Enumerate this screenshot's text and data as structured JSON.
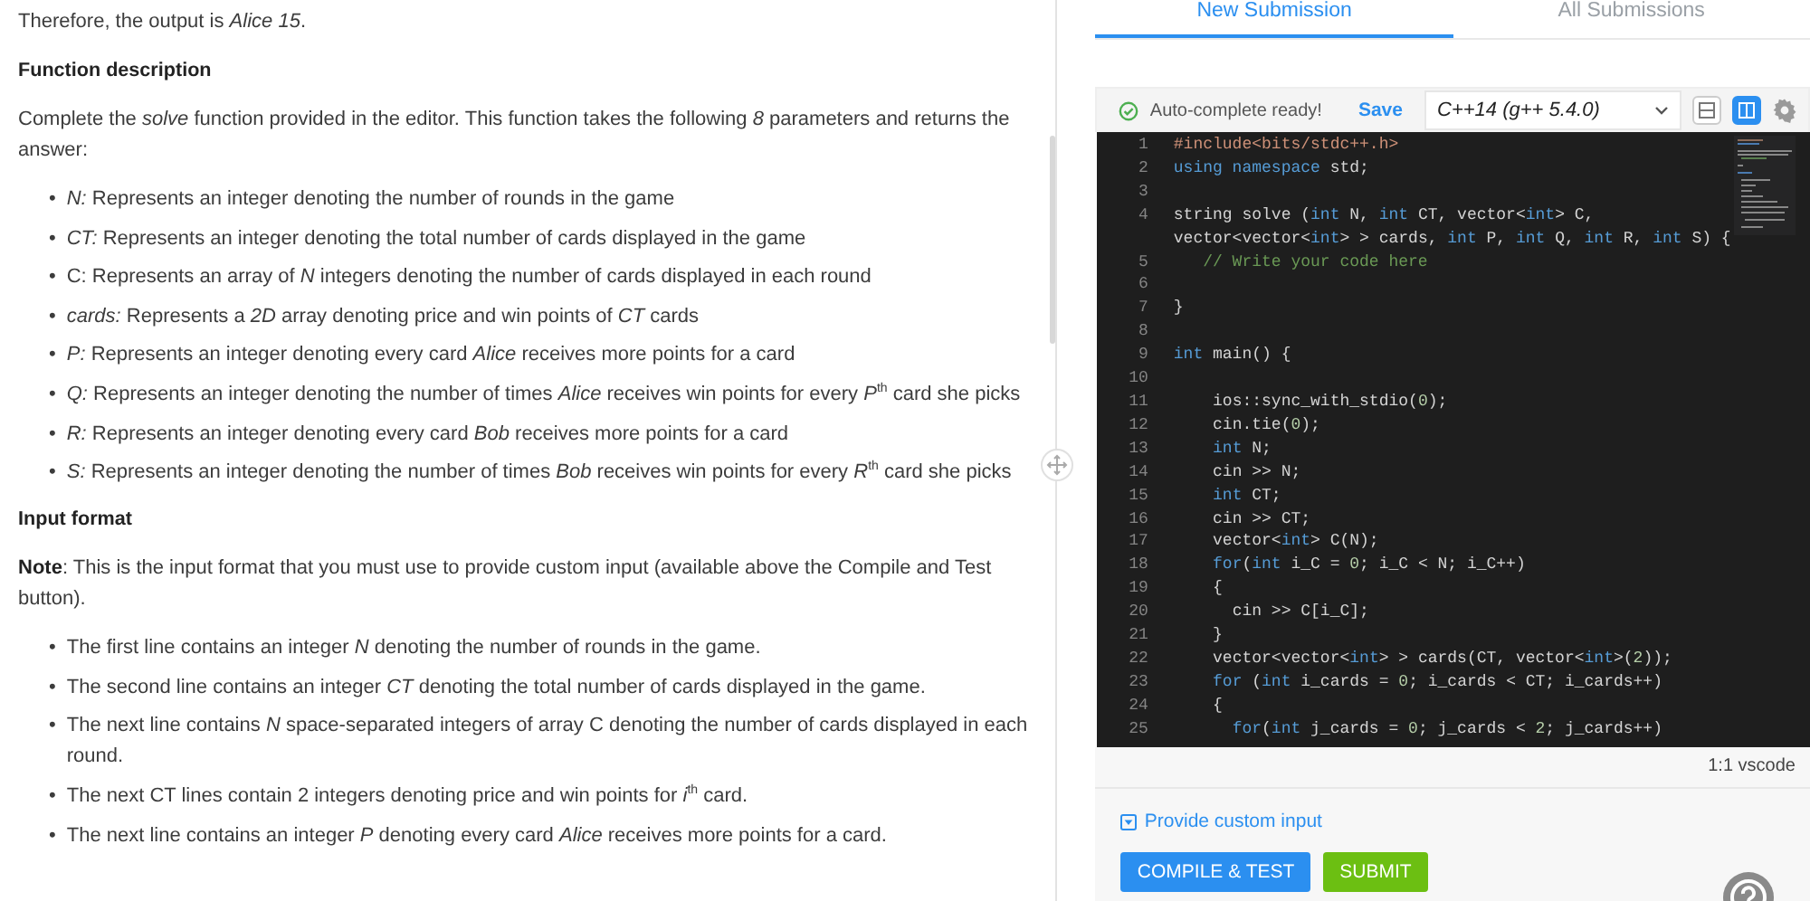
{
  "description": {
    "blocks": [
      {
        "kind": "paragraph",
        "text": "Therefore, the output is *Alice 15*."
      },
      {
        "kind": "heading",
        "text": "Function description"
      },
      {
        "kind": "paragraph",
        "text": "Complete the *solve* function provided in the editor. This function takes the following *8* parameters and returns the answer:"
      },
      {
        "kind": "bullets",
        "marker": "•",
        "items": [
          "*N:* Represents an integer denoting the number of rounds in the game",
          "*CT:* Represents an integer denoting the total number of cards displayed in the game",
          "C: Represents an array of *N* integers denoting the number of cards displayed in each round",
          "*cards:* Represents a *2D* array denoting price and win points of *CT* cards",
          "*P:* Represents an integer denoting every card *Alice* receives more points for a card",
          "*Q:* Represents an integer denoting the number of times *Alice* receives win points for every *P*$^{th}$ card she picks",
          "*R:* Represents an integer denoting every card *Bob* receives more points for a card",
          "*S:* Represents an integer denoting the number of times *Bob* receives win points for every *R*$^{th}$ card she picks"
        ]
      },
      {
        "kind": "heading",
        "text": "Input format"
      },
      {
        "kind": "paragraph",
        "text": "**Note**: This is the input format that you must use to provide custom input (available above the Compile and Test button)."
      },
      {
        "kind": "bullets",
        "marker": "•",
        "items": [
          "The first line contains an integer *N* denoting the number of rounds in the game.",
          "The second line contains an integer *CT* denoting the total number of cards displayed in the game.",
          "The next line contains *N* space-separated integers of array C denoting the number of cards displayed in each round.",
          "The next CT lines contain 2 integers denoting price and win points for *i*$^{th}$ card.",
          "The next line contains an integer *P* denoting every card *Alice* receives more points for a card."
        ]
      }
    ]
  },
  "tabs": [
    {
      "label": "New Submission",
      "selected": true
    },
    {
      "label": "All Submissions",
      "selected": false
    }
  ],
  "toolbar": {
    "status": "Auto-complete ready!",
    "save": "Save",
    "language": "C++14 (g++ 5.4.0)",
    "layouts": [
      {
        "kind": "stacked",
        "selected": false
      },
      {
        "kind": "split",
        "selected": true
      }
    ]
  },
  "editor": {
    "lines": [
      {
        "number": "1",
        "tokens": [
          {
            "kind": "pre",
            "text": "#include<bits/stdc++.h>"
          }
        ]
      },
      {
        "number": "2",
        "tokens": [
          {
            "kind": "kw",
            "text": "using namespace"
          },
          {
            "kind": "plain",
            "text": " std;"
          }
        ]
      },
      {
        "number": "3"
      },
      {
        "number": "4",
        "tokens": [
          {
            "kind": "plain",
            "text": "string solve ("
          },
          {
            "kind": "kw",
            "text": "int"
          },
          {
            "kind": "plain",
            "text": " N, "
          },
          {
            "kind": "kw",
            "text": "int"
          },
          {
            "kind": "plain",
            "text": " CT, vector<"
          },
          {
            "kind": "kw",
            "text": "int"
          },
          {
            "kind": "plain",
            "text": "> C, vector<vector<"
          },
          {
            "kind": "kw",
            "text": "int"
          },
          {
            "kind": "plain",
            "text": "> > cards, "
          },
          {
            "kind": "kw",
            "text": "int"
          },
          {
            "kind": "plain",
            "text": " P, "
          },
          {
            "kind": "kw",
            "text": "int"
          },
          {
            "kind": "plain",
            "text": " Q, "
          },
          {
            "kind": "kw",
            "text": "int"
          },
          {
            "kind": "plain",
            "text": " R, "
          },
          {
            "kind": "kw",
            "text": "int"
          },
          {
            "kind": "plain",
            "text": " S) {"
          }
        ]
      },
      {
        "number": "5",
        "tokens": [
          {
            "kind": "com",
            "text": "   // Write your code here"
          }
        ]
      },
      {
        "number": "6"
      },
      {
        "number": "7",
        "tokens": [
          {
            "kind": "plain",
            "text": "}"
          }
        ]
      },
      {
        "number": "8"
      },
      {
        "number": "9",
        "tokens": [
          {
            "kind": "kw",
            "text": "int"
          },
          {
            "kind": "plain",
            "text": " main() {"
          }
        ]
      },
      {
        "number": "10"
      },
      {
        "number": "11",
        "tokens": [
          {
            "kind": "plain",
            "text": "    ios::sync_with_stdio("
          },
          {
            "kind": "num",
            "text": "0"
          },
          {
            "kind": "plain",
            "text": ");"
          }
        ]
      },
      {
        "number": "12",
        "tokens": [
          {
            "kind": "plain",
            "text": "    cin.tie("
          },
          {
            "kind": "num",
            "text": "0"
          },
          {
            "kind": "plain",
            "text": ");"
          }
        ]
      },
      {
        "number": "13",
        "tokens": [
          {
            "kind": "kw",
            "text": "    int"
          },
          {
            "kind": "plain",
            "text": " N;"
          }
        ]
      },
      {
        "number": "14",
        "tokens": [
          {
            "kind": "plain",
            "text": "    cin >> N;"
          }
        ]
      },
      {
        "number": "15",
        "tokens": [
          {
            "kind": "kw",
            "text": "    int"
          },
          {
            "kind": "plain",
            "text": " CT;"
          }
        ]
      },
      {
        "number": "16",
        "tokens": [
          {
            "kind": "plain",
            "text": "    cin >> CT;"
          }
        ]
      },
      {
        "number": "17",
        "tokens": [
          {
            "kind": "plain",
            "text": "    vector<"
          },
          {
            "kind": "kw",
            "text": "int"
          },
          {
            "kind": "plain",
            "text": "> C(N);"
          }
        ]
      },
      {
        "number": "18",
        "tokens": [
          {
            "kind": "kw",
            "text": "    for"
          },
          {
            "kind": "plain",
            "text": "("
          },
          {
            "kind": "kw",
            "text": "int"
          },
          {
            "kind": "plain",
            "text": " i_C = "
          },
          {
            "kind": "num",
            "text": "0"
          },
          {
            "kind": "plain",
            "text": "; i_C < N; i_C++)"
          }
        ]
      },
      {
        "number": "19",
        "tokens": [
          {
            "kind": "plain",
            "text": "    {"
          }
        ]
      },
      {
        "number": "20",
        "tokens": [
          {
            "kind": "plain",
            "text": "      cin >> C[i_C];"
          }
        ]
      },
      {
        "number": "21",
        "tokens": [
          {
            "kind": "plain",
            "text": "    }"
          }
        ]
      },
      {
        "number": "22",
        "tokens": [
          {
            "kind": "plain",
            "text": "    vector<vector<"
          },
          {
            "kind": "kw",
            "text": "int"
          },
          {
            "kind": "plain",
            "text": "> > cards(CT, vector<"
          },
          {
            "kind": "kw",
            "text": "int"
          },
          {
            "kind": "plain",
            "text": ">("
          },
          {
            "kind": "num",
            "text": "2"
          },
          {
            "kind": "plain",
            "text": "));"
          }
        ]
      },
      {
        "number": "23",
        "tokens": [
          {
            "kind": "kw",
            "text": "    for"
          },
          {
            "kind": "plain",
            "text": " ("
          },
          {
            "kind": "kw",
            "text": "int"
          },
          {
            "kind": "plain",
            "text": " i_cards = "
          },
          {
            "kind": "num",
            "text": "0"
          },
          {
            "kind": "plain",
            "text": "; i_cards < CT; i_cards++)"
          }
        ]
      },
      {
        "number": "24",
        "tokens": [
          {
            "kind": "plain",
            "text": "    {"
          }
        ]
      },
      {
        "number": "25",
        "tokens": [
          {
            "kind": "kw",
            "text": "      for"
          },
          {
            "kind": "plain",
            "text": "("
          },
          {
            "kind": "kw",
            "text": "int"
          },
          {
            "kind": "plain",
            "text": " j_cards = "
          },
          {
            "kind": "num",
            "text": "0"
          },
          {
            "kind": "plain",
            "text": "; j_cards < "
          },
          {
            "kind": "num",
            "text": "2"
          },
          {
            "kind": "plain",
            "text": "; j_cards++)"
          }
        ]
      }
    ]
  },
  "status_bar": {
    "text": "1:1 vscode"
  },
  "custom_input": {
    "label": "Provide custom input"
  },
  "buttons": [
    {
      "label": "COMPILE & TEST",
      "kind": "primary"
    },
    {
      "label": "SUBMIT",
      "kind": "success"
    }
  ]
}
